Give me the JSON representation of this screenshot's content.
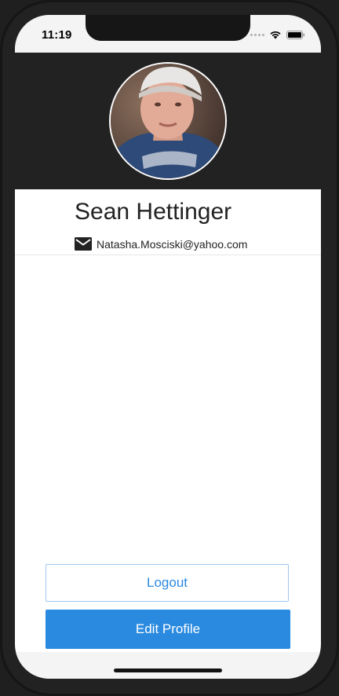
{
  "status_bar": {
    "time": "11:19"
  },
  "profile": {
    "name": "Sean Hettinger",
    "email": "Natasha.Mosciski@yahoo.com",
    "avatar_icon": "user-photo"
  },
  "actions": {
    "logout_label": "Logout",
    "edit_label": "Edit Profile"
  },
  "colors": {
    "header_background": "#222222",
    "accent": "#2a8ae0"
  }
}
